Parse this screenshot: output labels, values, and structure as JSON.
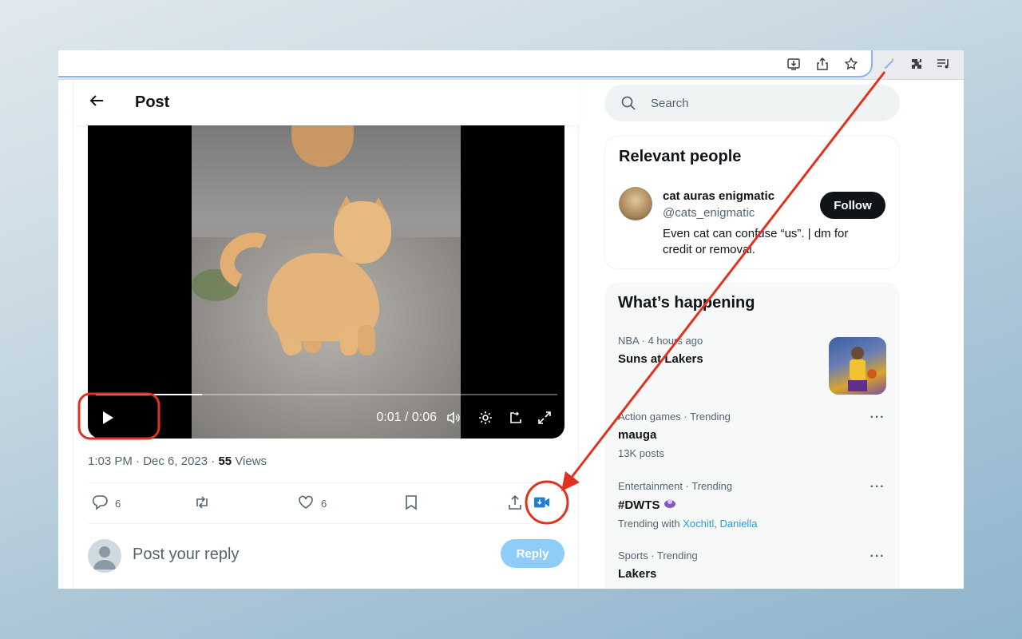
{
  "post": {
    "title": "Post",
    "video": {
      "time": "0:01 / 0:06",
      "progress": 0.23
    },
    "time": "1:03 PM",
    "date": "Dec 6, 2023",
    "views_count": "55",
    "views_label": "Views",
    "separator": "·",
    "replies_count": "6",
    "likes_count": "6",
    "reply_placeholder": "Post your reply",
    "reply_button": "Reply"
  },
  "search": {
    "placeholder": "Search"
  },
  "relevant_people": {
    "title": "Relevant people",
    "person": {
      "name": "cat auras enigmatic",
      "handle": "@cats_enigmatic",
      "bio": "Even cat can confuse “us”. | dm for credit or removal.",
      "follow_label": "Follow"
    }
  },
  "whats_happening": {
    "title": "What’s happening",
    "trends": [
      {
        "meta": "NBA · 4 hours ago",
        "name": "Suns at Lakers",
        "sub": ""
      },
      {
        "meta": "Action games · Trending",
        "name": "mauga",
        "sub": "13K posts"
      },
      {
        "meta": "Entertainment · Trending",
        "name": "#DWTS",
        "sub_prefix": "Trending with",
        "sub_link1": "Xochitl",
        "sub_sep": ",",
        "sub_link2": "Daniella"
      },
      {
        "meta": "Sports · Trending",
        "name": "Lakers",
        "sub": ""
      }
    ],
    "more_label": "···"
  },
  "colors": {
    "accent": "#1d9bf0",
    "annotation": "#e0321f",
    "download_icon": "#1d7fd8"
  },
  "icons": {
    "back": "arrow-left-icon",
    "search": "search-icon",
    "play": "play-icon",
    "download_video": "video-download-icon"
  }
}
